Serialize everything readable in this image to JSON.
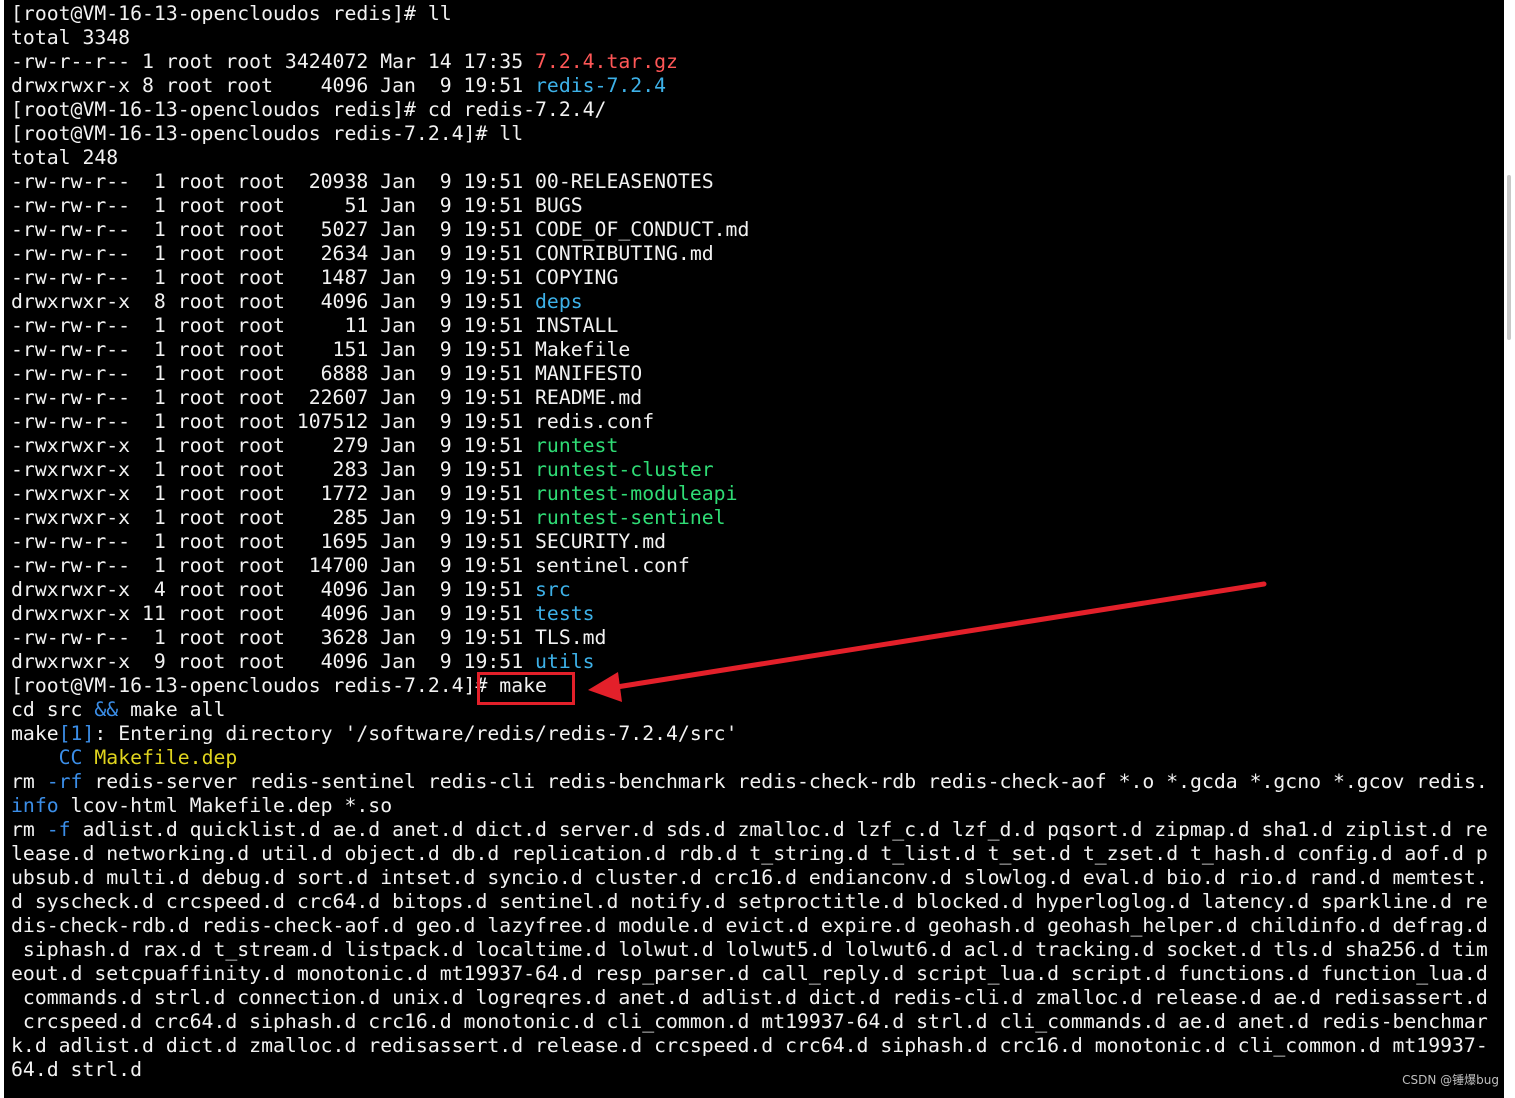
{
  "terminal": {
    "lines": [
      [
        {
          "t": "[root@VM-16-13-opencloudos redis]# ll"
        }
      ],
      [
        {
          "t": "total 3348"
        }
      ],
      [
        {
          "t": "-rw-r--r-- 1 root root 3424072 Mar 14 17:35 "
        },
        {
          "t": "7.2.4.tar.gz",
          "c": "archive"
        }
      ],
      [
        {
          "t": "drwxrwxr-x 8 root root    4096 Jan  9 19:51 "
        },
        {
          "t": "redis-7.2.4",
          "c": "dir"
        }
      ],
      [
        {
          "t": "[root@VM-16-13-opencloudos redis]# cd redis-7.2.4/"
        }
      ],
      [
        {
          "t": "[root@VM-16-13-opencloudos redis-7.2.4]# ll"
        }
      ],
      [
        {
          "t": "total 248"
        }
      ],
      [
        {
          "t": "-rw-rw-r--  1 root root  20938 Jan  9 19:51 00-RELEASENOTES"
        }
      ],
      [
        {
          "t": "-rw-rw-r--  1 root root     51 Jan  9 19:51 BUGS"
        }
      ],
      [
        {
          "t": "-rw-rw-r--  1 root root   5027 Jan  9 19:51 CODE_OF_CONDUCT.md"
        }
      ],
      [
        {
          "t": "-rw-rw-r--  1 root root   2634 Jan  9 19:51 CONTRIBUTING.md"
        }
      ],
      [
        {
          "t": "-rw-rw-r--  1 root root   1487 Jan  9 19:51 COPYING"
        }
      ],
      [
        {
          "t": "drwxrwxr-x  8 root root   4096 Jan  9 19:51 "
        },
        {
          "t": "deps",
          "c": "dir"
        }
      ],
      [
        {
          "t": "-rw-rw-r--  1 root root     11 Jan  9 19:51 INSTALL"
        }
      ],
      [
        {
          "t": "-rw-rw-r--  1 root root    151 Jan  9 19:51 Makefile"
        }
      ],
      [
        {
          "t": "-rw-rw-r--  1 root root   6888 Jan  9 19:51 MANIFESTO"
        }
      ],
      [
        {
          "t": "-rw-rw-r--  1 root root  22607 Jan  9 19:51 README.md"
        }
      ],
      [
        {
          "t": "-rw-rw-r--  1 root root 107512 Jan  9 19:51 redis.conf"
        }
      ],
      [
        {
          "t": "-rwxrwxr-x  1 root root    279 Jan  9 19:51 "
        },
        {
          "t": "runtest",
          "c": "exec"
        }
      ],
      [
        {
          "t": "-rwxrwxr-x  1 root root    283 Jan  9 19:51 "
        },
        {
          "t": "runtest-cluster",
          "c": "exec"
        }
      ],
      [
        {
          "t": "-rwxrwxr-x  1 root root   1772 Jan  9 19:51 "
        },
        {
          "t": "runtest-moduleapi",
          "c": "exec"
        }
      ],
      [
        {
          "t": "-rwxrwxr-x  1 root root    285 Jan  9 19:51 "
        },
        {
          "t": "runtest-sentinel",
          "c": "exec"
        }
      ],
      [
        {
          "t": "-rw-rw-r--  1 root root   1695 Jan  9 19:51 SECURITY.md"
        }
      ],
      [
        {
          "t": "-rw-rw-r--  1 root root  14700 Jan  9 19:51 sentinel.conf"
        }
      ],
      [
        {
          "t": "drwxrwxr-x  4 root root   4096 Jan  9 19:51 "
        },
        {
          "t": "src",
          "c": "dir"
        }
      ],
      [
        {
          "t": "drwxrwxr-x 11 root root   4096 Jan  9 19:51 "
        },
        {
          "t": "tests",
          "c": "dir"
        }
      ],
      [
        {
          "t": "-rw-rw-r--  1 root root   3628 Jan  9 19:51 TLS.md"
        }
      ],
      [
        {
          "t": "drwxrwxr-x  9 root root   4096 Jan  9 19:51 "
        },
        {
          "t": "utils",
          "c": "dir"
        }
      ],
      [
        {
          "t": "[root@VM-16-13-opencloudos redis-7.2.4]# make"
        }
      ],
      [
        {
          "t": "cd src "
        },
        {
          "t": "&&",
          "c": "cyan"
        },
        {
          "t": " make all"
        }
      ],
      [
        {
          "t": "make"
        },
        {
          "t": "[1]",
          "c": "cyan"
        },
        {
          "t": ": Entering directory '/software/redis/redis-7.2.4/src'"
        }
      ],
      [
        {
          "t": "    "
        },
        {
          "t": "CC",
          "c": "cyan"
        },
        {
          "t": " "
        },
        {
          "t": "Makefile.dep",
          "c": "cc"
        }
      ],
      [
        {
          "t": "rm "
        },
        {
          "t": "-rf",
          "c": "cyan"
        },
        {
          "t": " redis-server redis-sentinel redis-cli redis-benchmark redis-check-rdb redis-check-aof *.o *.gcda *.gcno *.gcov redis."
        }
      ],
      [
        {
          "t": "info",
          "c": "cyan"
        },
        {
          "t": " lcov-html Makefile.dep *.so"
        }
      ],
      [
        {
          "t": "rm "
        },
        {
          "t": "-f",
          "c": "cyan"
        },
        {
          "t": " adlist.d quicklist.d ae.d anet.d dict.d server.d sds.d zmalloc.d lzf_c.d lzf_d.d pqsort.d zipmap.d sha1.d ziplist.d re"
        }
      ],
      [
        {
          "t": "lease.d networking.d util.d object.d db.d replication.d rdb.d t_string.d t_list.d t_set.d t_zset.d t_hash.d config.d aof.d p"
        }
      ],
      [
        {
          "t": "ubsub.d multi.d debug.d sort.d intset.d syncio.d cluster.d crc16.d endianconv.d slowlog.d eval.d bio.d rio.d rand.d memtest."
        }
      ],
      [
        {
          "t": "d syscheck.d crcspeed.d crc64.d bitops.d sentinel.d notify.d setproctitle.d blocked.d hyperloglog.d latency.d sparkline.d re"
        }
      ],
      [
        {
          "t": "dis-check-rdb.d redis-check-aof.d geo.d lazyfree.d module.d evict.d expire.d geohash.d geohash_helper.d childinfo.d defrag.d"
        }
      ],
      [
        {
          "t": " siphash.d rax.d t_stream.d listpack.d localtime.d lolwut.d lolwut5.d lolwut6.d acl.d tracking.d socket.d tls.d sha256.d tim"
        }
      ],
      [
        {
          "t": "eout.d setcpuaffinity.d monotonic.d mt19937-64.d resp_parser.d call_reply.d script_lua.d script.d functions.d function_lua.d"
        }
      ],
      [
        {
          "t": " commands.d strl.d connection.d unix.d logreqres.d anet.d adlist.d dict.d redis-cli.d zmalloc.d release.d ae.d redisassert.d"
        }
      ],
      [
        {
          "t": " crcspeed.d crc64.d siphash.d crc16.d monotonic.d cli_common.d mt19937-64.d strl.d cli_commands.d ae.d anet.d redis-benchmar"
        }
      ],
      [
        {
          "t": "k.d adlist.d dict.d zmalloc.d redisassert.d release.d crcspeed.d crc64.d siphash.d crc16.d monotonic.d cli_common.d mt19937-"
        }
      ],
      [
        {
          "t": "64.d strl.d"
        }
      ]
    ]
  },
  "colors": {
    "background": "#000000",
    "foreground": "#f2f2f2",
    "dir": "#3db1e8",
    "exec": "#2fdc75",
    "archive": "#ff5757",
    "cc": "#e0d41e",
    "annotation_red": "#e3202a"
  },
  "watermark": "CSDN @锤爆bug"
}
